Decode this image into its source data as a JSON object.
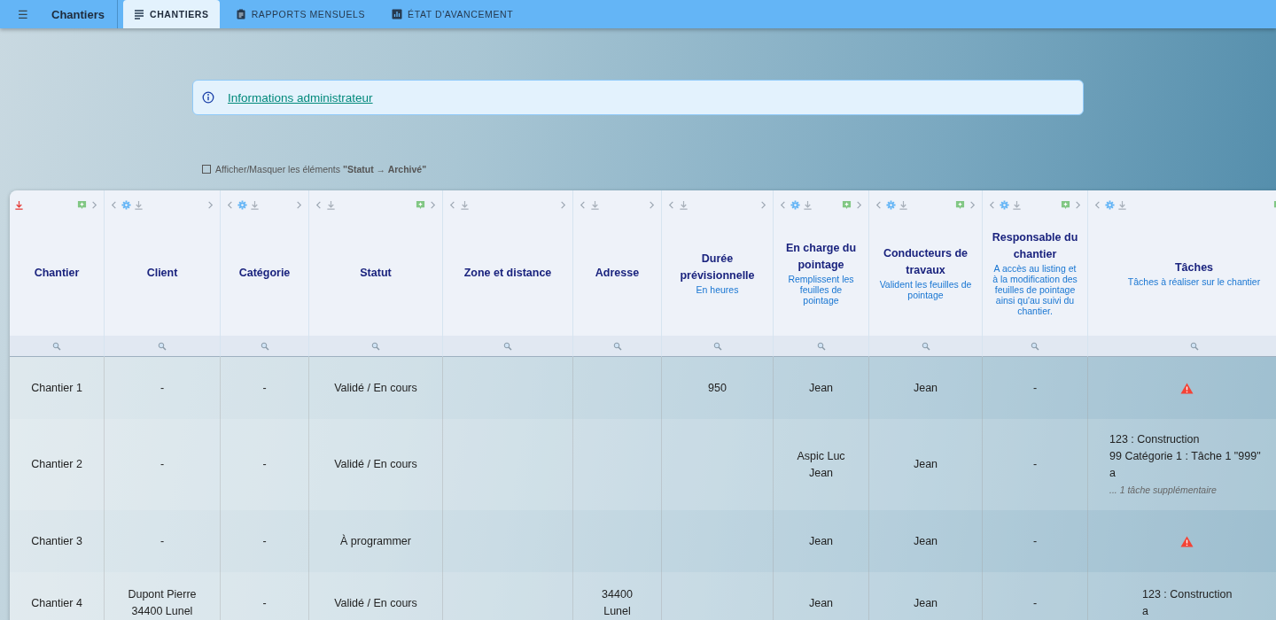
{
  "app_bar": {
    "menu_icon": "☰",
    "title": "Chantiers",
    "tabs": [
      {
        "label": "CHANTIERS",
        "selected": true
      },
      {
        "label": "RAPPORTS MENSUELS",
        "selected": false
      },
      {
        "label": "ÉTAT D'AVANCEMENT",
        "selected": false
      }
    ]
  },
  "info_banner": {
    "link": "Informations administrateur"
  },
  "archive_toggle": {
    "label": "Afficher/Masquer les éléments **\"Statut → Archivé\"**",
    "checked": false
  },
  "table": {
    "columns": [
      {
        "title": "Chantier",
        "sorted": true,
        "settings": false,
        "add": true
      },
      {
        "title": "Client",
        "sorted": false,
        "settings": true,
        "add": false
      },
      {
        "title": "Catégorie",
        "sorted": false,
        "settings": true,
        "add": false
      },
      {
        "title": "Statut",
        "sorted": false,
        "settings": false,
        "add": true
      },
      {
        "title": "Zone et distance",
        "sorted": false,
        "settings": false,
        "add": false
      },
      {
        "title": "Adresse",
        "sorted": false,
        "settings": false,
        "add": false
      },
      {
        "title": "Durée prévisionnelle",
        "subtitle": "En heures",
        "sorted": false,
        "settings": false,
        "add": false
      },
      {
        "title": "En charge du pointage",
        "subtitle": "Remplissent les feuilles de pointage",
        "sorted": false,
        "settings": true,
        "add": true
      },
      {
        "title": "Conducteurs de travaux",
        "subtitle": "Valident les feuilles de pointage",
        "sorted": false,
        "settings": true,
        "add": true
      },
      {
        "title": "Responsable du chantier",
        "subtitle": "A accès au listing et à la modification des feuilles de pointage ainsi qu'au suivi du chantier.",
        "sorted": false,
        "settings": true,
        "add": true
      },
      {
        "title": "Tâches",
        "subtitle": "Tâches à réaliser sur le chantier",
        "sorted": false,
        "settings": true,
        "add": true
      }
    ],
    "rows": [
      {
        "cells": [
          [
            "Chantier 1"
          ],
          [
            "-"
          ],
          [
            "-"
          ],
          [
            "Validé / En cours"
          ],
          null,
          null,
          [
            "950"
          ],
          [
            "Jean"
          ],
          [
            "Jean"
          ],
          [
            "-"
          ]
        ],
        "taches": {
          "kind": "warning"
        }
      },
      {
        "cells": [
          [
            "Chantier 2"
          ],
          [
            "-"
          ],
          [
            "-"
          ],
          [
            "Validé / En cours"
          ],
          null,
          null,
          null,
          [
            "Aspic Luc",
            "Jean"
          ],
          [
            "Jean"
          ],
          [
            "-"
          ]
        ],
        "taches": {
          "kind": "list",
          "lines": [
            "123 : Construction",
            "99 Catégorie 1 : Tâche 1 \"999\"",
            "a"
          ],
          "more": "... 1 tâche supplémentaire"
        }
      },
      {
        "cells": [
          [
            "Chantier 3"
          ],
          [
            "-"
          ],
          [
            "-"
          ],
          [
            "À programmer"
          ],
          null,
          null,
          null,
          [
            "Jean"
          ],
          [
            "Jean"
          ],
          [
            "-"
          ]
        ],
        "taches": {
          "kind": "warning"
        }
      },
      {
        "cells": [
          [
            "Chantier 4"
          ],
          [
            "Dupont Pierre",
            "34400 Lunel"
          ],
          [
            "-"
          ],
          [
            "Validé / En cours"
          ],
          null,
          [
            "34400",
            "Lunel"
          ],
          null,
          [
            "Jean"
          ],
          [
            "Jean"
          ],
          [
            "-"
          ]
        ],
        "taches": {
          "kind": "list",
          "lines": [
            "123 : Construction",
            "a"
          ]
        }
      }
    ]
  }
}
